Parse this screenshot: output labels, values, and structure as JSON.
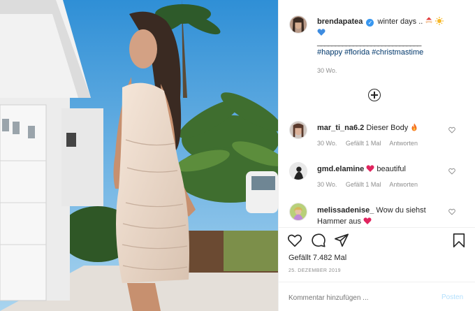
{
  "post": {
    "username": "brendapatea",
    "caption_text": "winter days ..",
    "caption_separator": "_____________________________",
    "hashtags": "#happy #florida #christmastime",
    "caption_age": "30 Wo.",
    "likes": "Gefällt 7.482 Mal",
    "date": "25. DEZEMBER 2019",
    "comment_placeholder": "Kommentar hinzufügen ...",
    "post_button": "Posten"
  },
  "comments": [
    {
      "username": "mar_ti_na6.2",
      "text": "Dieser Body",
      "age": "30 Wo.",
      "likes": "Gefällt 1 Mal",
      "reply": "Antworten"
    },
    {
      "username": "gmd.elamine",
      "text": "beautiful",
      "age": "30 Wo.",
      "likes": "Gefällt 1 Mal",
      "reply": "Antworten"
    },
    {
      "username": "melissadenise_",
      "text": "Wow du siehst Hammer aus"
    }
  ],
  "colors": {
    "link": "#00376b",
    "verified": "#3897f0",
    "heart": "#ed4956",
    "meta": "#8e8e8e",
    "post_button": "#b2dffc"
  },
  "icons": {
    "like": "heart-outline-icon",
    "comment": "speech-bubble-icon",
    "share": "paper-plane-icon",
    "save": "bookmark-icon",
    "load_more": "plus-circle-icon"
  }
}
